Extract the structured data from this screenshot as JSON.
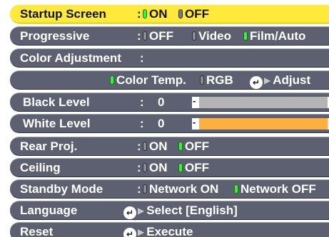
{
  "colors": {
    "row_bg": "#5d6070",
    "selected_bg": "#ffea3c",
    "indicator_on": "#3df23d",
    "black_level_bar": "#b4b4b4",
    "white_level_bar": "#fbb040"
  },
  "startup_screen": {
    "label": "Startup Screen",
    "colon": ":",
    "on": "ON",
    "off": "OFF",
    "selected": "ON"
  },
  "progressive": {
    "label": "Progressive",
    "colon": ":",
    "off": "OFF",
    "video": "Video",
    "film_auto": "Film/Auto",
    "selected": "Film/Auto"
  },
  "color_adjustment": {
    "label": "Color Adjustment",
    "colon": ":"
  },
  "color_mode": {
    "color_temp": "Color Temp.",
    "rgb": "RGB",
    "adjust": "Adjust",
    "selected": "Color Temp."
  },
  "black_level": {
    "label": "Black Level",
    "colon": ":",
    "value": "0",
    "minus": "-",
    "plus": "+",
    "fill": 1.0
  },
  "white_level": {
    "label": "White Level",
    "colon": ":",
    "value": "0",
    "minus": "-",
    "plus": "+",
    "fill": 1.0
  },
  "rear_proj": {
    "label": "Rear Proj.",
    "colon": ":",
    "on": "ON",
    "off": "OFF",
    "selected": "OFF"
  },
  "ceiling": {
    "label": "Ceiling",
    "colon": ":",
    "on": "ON",
    "off": "OFF",
    "selected": "OFF"
  },
  "standby_mode": {
    "label": "Standby Mode",
    "colon": ":",
    "network_on": "Network ON",
    "network_off": "Network OFF",
    "selected": "Network OFF"
  },
  "language": {
    "label": "Language",
    "action": "Select",
    "current": "[English]"
  },
  "reset": {
    "label": "Reset",
    "action": "Execute"
  }
}
